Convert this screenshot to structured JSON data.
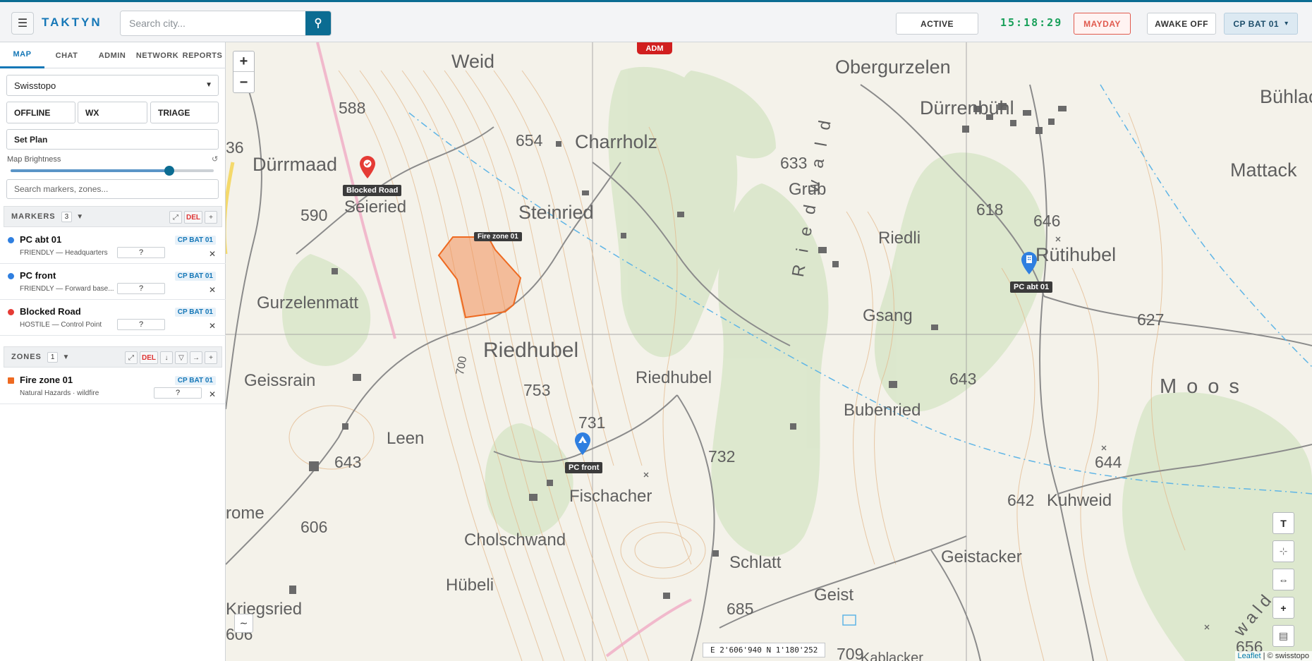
{
  "header": {
    "menu_icon": "hamburger-icon",
    "brand": "TAKTYN",
    "search_placeholder": "Search city...",
    "search_icon": "pin-search-icon",
    "status": "ACTIVE",
    "clock": "15:18:29",
    "mayday": "MAYDAY",
    "awake": "AWAKE OFF",
    "unit": "CP BAT 01",
    "unit_caret": "▾"
  },
  "sidebar": {
    "tabs": [
      "MAP",
      "CHAT",
      "ADMIN",
      "NETWORK",
      "REPORTS"
    ],
    "active_tab": "MAP",
    "map_source": "Swisstopo",
    "mode_buttons": [
      "OFFLINE",
      "WX",
      "TRIAGE"
    ],
    "set_plan": "Set Plan",
    "brightness_label": "Map Brightness",
    "brightness_reset_icon": "↺",
    "brightness_value": 0.78,
    "filter_placeholder": "Search markers, zones...",
    "markers": {
      "title": "MARKERS",
      "count": "3",
      "del": "DEL",
      "items": [
        {
          "title": "PC abt 01",
          "subtitle": "FRIENDLY — Headquarters",
          "unit": "CP BAT 01",
          "qty": "?",
          "color": "#2f7fe0"
        },
        {
          "title": "PC front",
          "subtitle": "FRIENDLY — Forward base...",
          "unit": "CP BAT 01",
          "qty": "?",
          "color": "#2f7fe0"
        },
        {
          "title": "Blocked Road",
          "subtitle": "HOSTILE — Control Point",
          "unit": "CP BAT 01",
          "qty": "?",
          "color": "#e53b35"
        }
      ]
    },
    "zones": {
      "title": "ZONES",
      "count": "1",
      "del": "DEL",
      "items": [
        {
          "title": "Fire zone 01",
          "subtitle": "Natural Hazards · wildfire",
          "unit": "CP BAT 01",
          "qty": "?",
          "color": "#ee6a21"
        }
      ]
    }
  },
  "map": {
    "zoom_in": "+",
    "zoom_out": "−",
    "adm_badge": "ADM",
    "coordinates": "E 2'606'940 N 1'180'252",
    "attribution_link": "Leaflet",
    "attribution_rest": " | © swisstopo",
    "markers": {
      "blocked": "Blocked Road",
      "abt": "PC abt 01",
      "front": "PC front",
      "zone": "Fire zone 01"
    },
    "right_tools": [
      "T",
      "⊹",
      "⇔",
      "+",
      "▤"
    ],
    "wave_icon": "∼",
    "places": {
      "weid": "Weid",
      "obergurzelen": "Obergurzelen",
      "duerrenbuehl": "Dürrenbühl",
      "buehlacker": "Bühlac",
      "charrholz": "Charrholz",
      "duerrmaad": "Dürrmaad",
      "seieried": "Seieried",
      "steinried": "Steinried",
      "grub": "Grub",
      "riedli": "Riedli",
      "ruetihubel": "Rütihubel",
      "mattacker": "Mattack",
      "gurzelenmatt": "Gurzelenmatt",
      "gsang": "Gsang",
      "riedhubel_big": "Riedhubel",
      "riedhubel_small": "Riedhubel",
      "geissrain": "Geissrain",
      "bubenried": "Bubenried",
      "moos": "Moos",
      "leen": "Leen",
      "fischacher": "Fischacher",
      "kuhweid": "Kuhweid",
      "rome": "rome",
      "cholschwand": "Cholschwand",
      "schlatt": "Schlatt",
      "geistacker": "Geistacker",
      "huebeli": "Hübeli",
      "kriegsried": "Kriegsried",
      "geist": "Geist",
      "riedwald": "Riedwald",
      "wald": "wald",
      "kablacker": "Kablacker"
    },
    "altitudes": {
      "a588": "588",
      "a654": "654",
      "a633": "633",
      "a618": "618",
      "a646": "646",
      "a590": "590",
      "a627": "627",
      "a643r": "643",
      "a753": "753",
      "a731": "731",
      "a732": "732",
      "a644": "644",
      "a643l": "643",
      "a606": "606",
      "a642": "642",
      "a685": "685",
      "a709": "709",
      "a656": "656",
      "a36": "36",
      "a606b": "606",
      "a700": "700"
    }
  }
}
